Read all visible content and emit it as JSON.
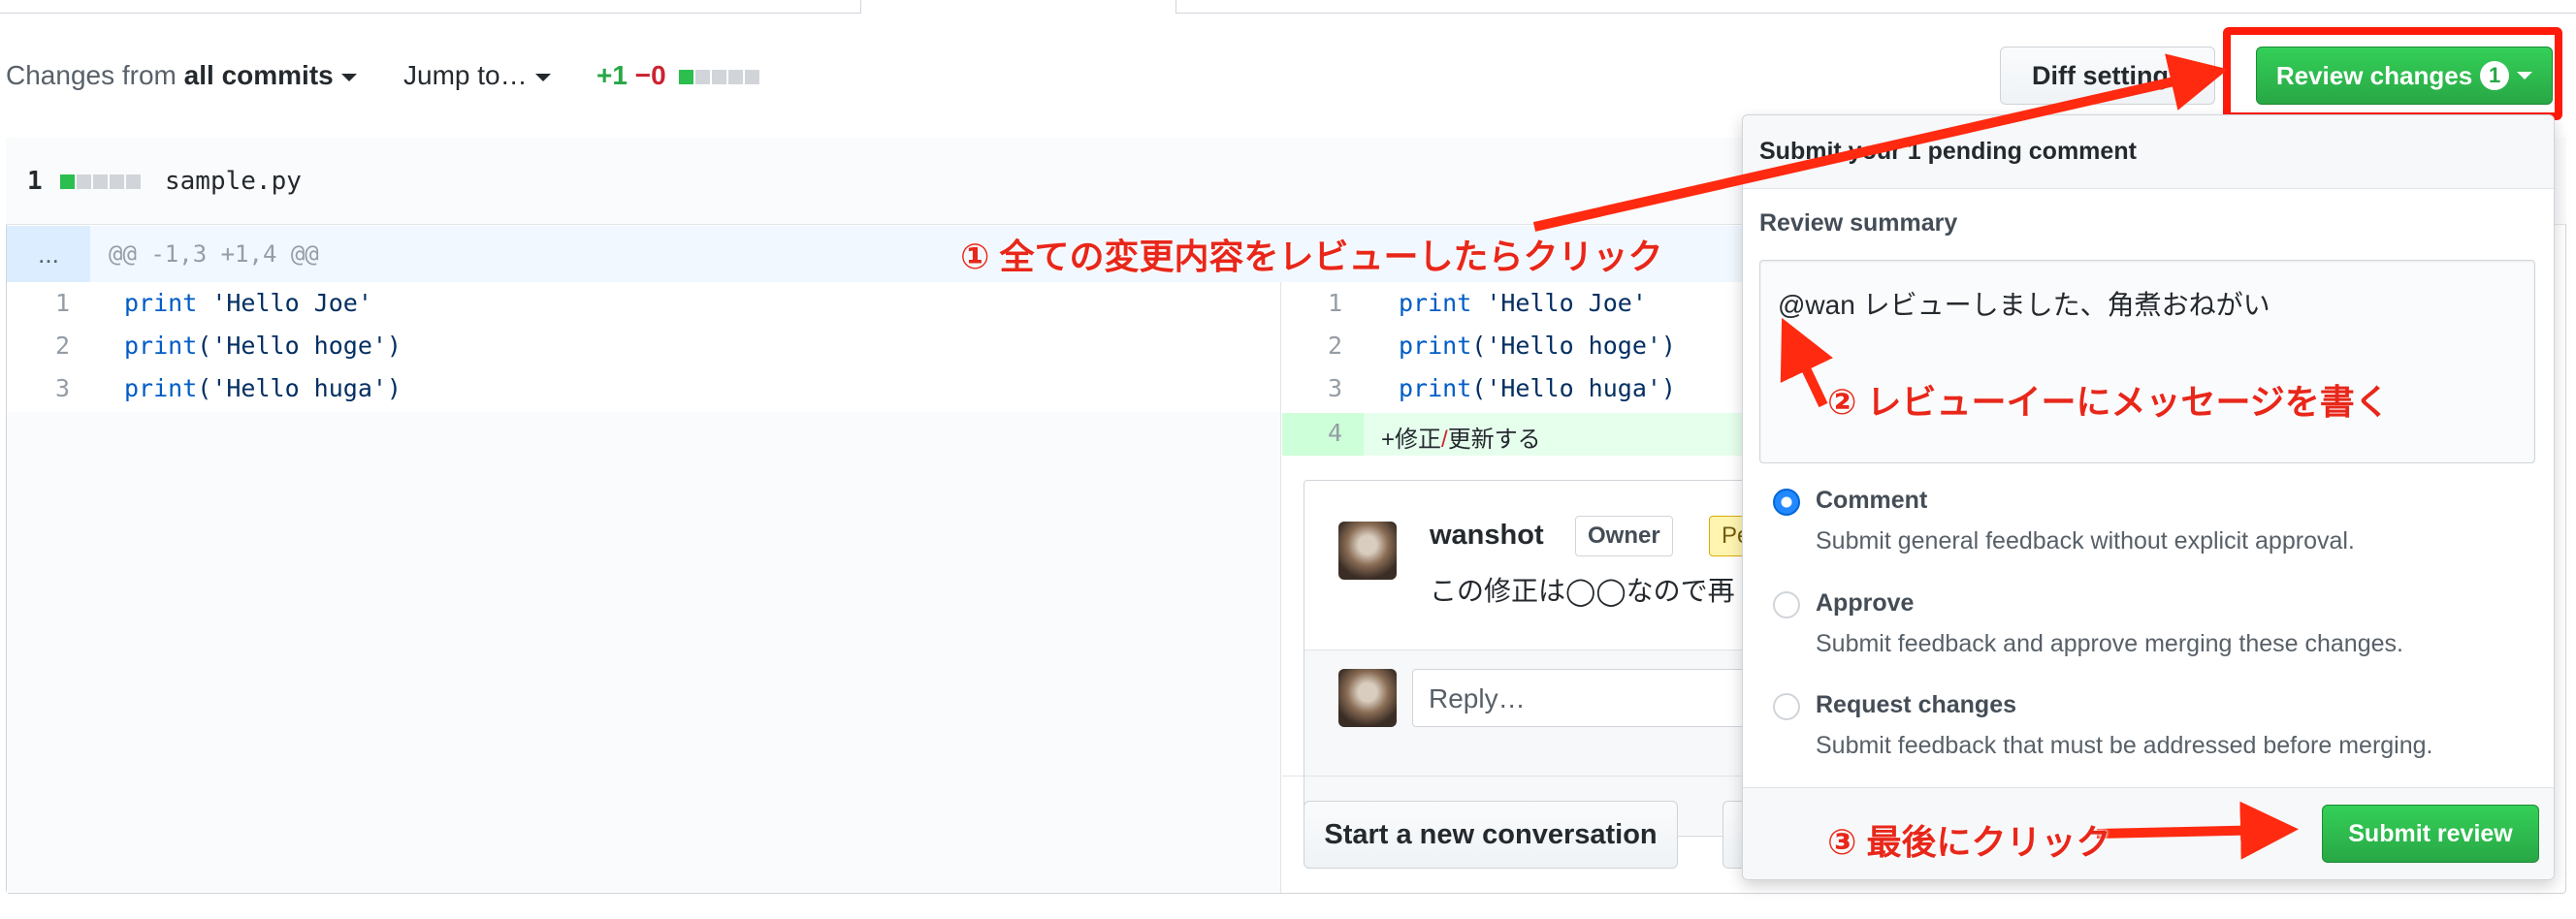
{
  "toolbar": {
    "changes_prefix": "Changes from",
    "changes_value": "all commits",
    "jump_to": "Jump to…",
    "additions": "+1",
    "deletions": "−0",
    "diff_settings": "Diff settings",
    "review_changes": "Review changes",
    "review_badge": "1"
  },
  "file": {
    "count": "1",
    "name": "sample.py",
    "expand": "...",
    "hunk": "@@ -1,3 +1,4 @@",
    "left_lines": [
      {
        "num": "1",
        "kw": "print",
        "rest": " 'Hello Joe'"
      },
      {
        "num": "2",
        "kw": "print",
        "rest": "('Hello hoge')"
      },
      {
        "num": "3",
        "kw": "print",
        "rest": "('Hello huga')"
      }
    ],
    "right_lines": [
      {
        "num": "1",
        "kw": "print",
        "rest": " 'Hello Joe'"
      },
      {
        "num": "2",
        "kw": "print",
        "rest": "('Hello hoge')"
      },
      {
        "num": "3",
        "kw": "print",
        "rest": "('Hello huga')"
      }
    ],
    "added_line": {
      "num": "4",
      "pre": "+修正",
      "slash": "/",
      "post": "更新する"
    }
  },
  "comment": {
    "author": "wanshot",
    "role": "Owner",
    "pending": "Pe",
    "body": "この修正は◯◯なので再",
    "reply_placeholder": "Reply…",
    "start_conversation": "Start a new conversation"
  },
  "review_panel": {
    "header": "Submit your 1 pending comment",
    "summary_label": "Review summary",
    "summary_text": "@wan レビューしました、角煮おねがい",
    "options": [
      {
        "label": "Comment",
        "desc": "Submit general feedback without explicit approval.",
        "checked": true
      },
      {
        "label": "Approve",
        "desc": "Submit feedback and approve merging these changes.",
        "checked": false
      },
      {
        "label": "Request changes",
        "desc": "Submit feedback that must be addressed before merging.",
        "checked": false
      }
    ],
    "submit": "Submit review"
  },
  "annotations": {
    "a1": "① 全ての変更内容をレビューしたらクリック",
    "a2": "② レビューイーにメッセージを書く",
    "a3": "③ 最後にクリック"
  },
  "colors": {
    "annotation": "#e8271a",
    "green": "#28a745",
    "add_bg": "#e6ffed",
    "hunk_bg": "#f1f8ff"
  }
}
